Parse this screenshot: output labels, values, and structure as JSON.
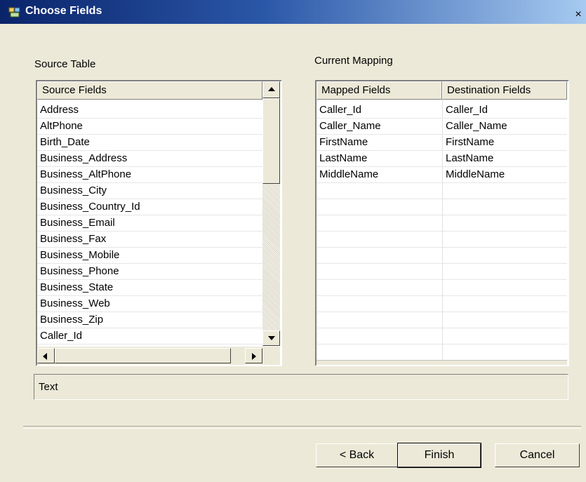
{
  "window": {
    "title": "Choose Fields",
    "close_glyph": "×",
    "icon": "app-icon"
  },
  "source": {
    "label": "Source Table",
    "column_header": "Source Fields",
    "items": [
      "Address",
      "AltPhone",
      "Birth_Date",
      "Business_Address",
      "Business_AltPhone",
      "Business_City",
      "Business_Country_Id",
      "Business_Email",
      "Business_Fax",
      "Business_Mobile",
      "Business_Phone",
      "Business_State",
      "Business_Web",
      "Business_Zip",
      "Caller_Id"
    ]
  },
  "mapping": {
    "label": "Current Mapping",
    "headers": [
      "Mapped Fields",
      "Destination Fields"
    ],
    "rows": [
      [
        "Caller_Id",
        "Caller_Id"
      ],
      [
        "Caller_Name",
        "Caller_Name"
      ],
      [
        "FirstName",
        "FirstName"
      ],
      [
        "LastName",
        "LastName"
      ],
      [
        "MiddleName",
        "MiddleName"
      ]
    ]
  },
  "status_text": "Text",
  "buttons": {
    "back": "< Back",
    "finish": "Finish",
    "cancel": "Cancel"
  }
}
